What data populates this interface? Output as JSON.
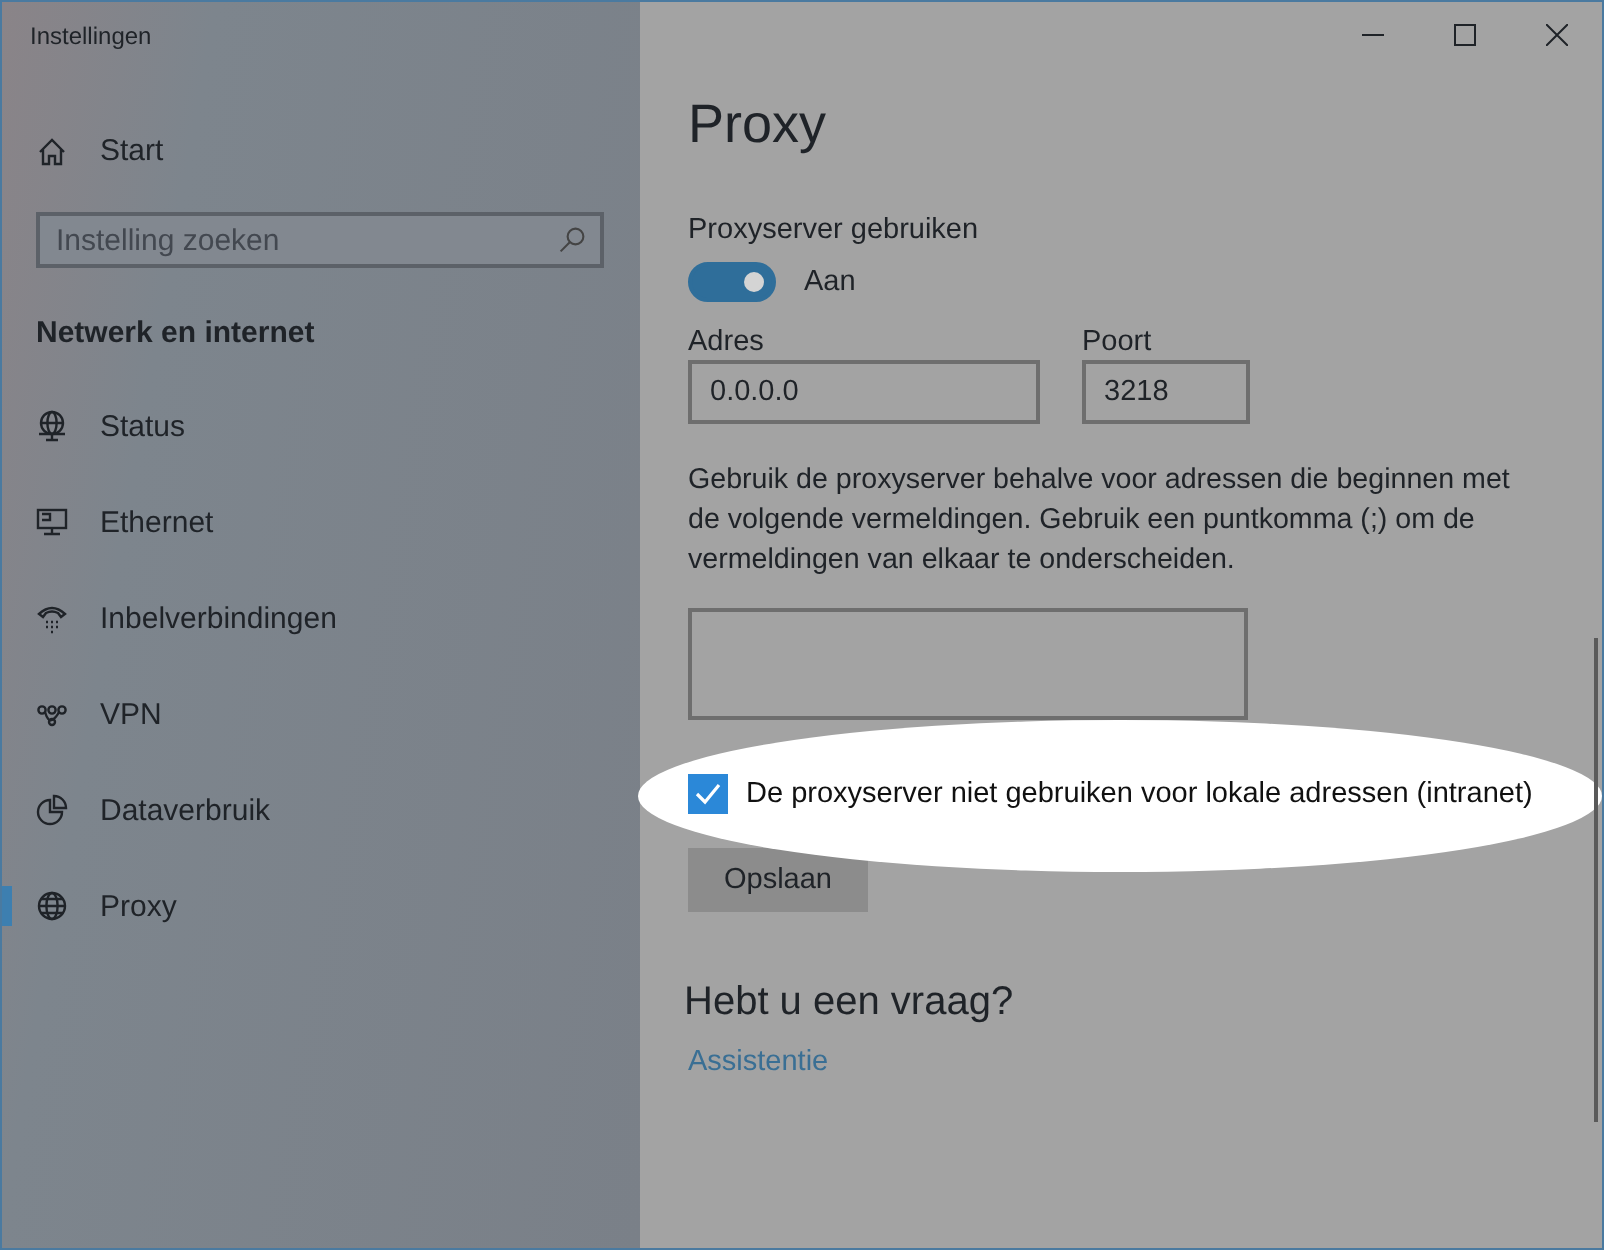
{
  "window": {
    "title": "Instellingen"
  },
  "sidebar": {
    "home": {
      "label": "Start"
    },
    "search": {
      "placeholder": "Instelling zoeken"
    },
    "section": "Netwerk en internet",
    "items": [
      {
        "label": "Status",
        "kind": "status",
        "selected": false
      },
      {
        "label": "Ethernet",
        "kind": "ethernet",
        "selected": false
      },
      {
        "label": "Inbelverbindingen",
        "kind": "dialup",
        "selected": false
      },
      {
        "label": "VPN",
        "kind": "vpn",
        "selected": false
      },
      {
        "label": "Dataverbruik",
        "kind": "data",
        "selected": false
      },
      {
        "label": "Proxy",
        "kind": "proxy",
        "selected": true
      }
    ]
  },
  "page": {
    "title": "Proxy",
    "proxy_toggle": {
      "label": "Proxyserver gebruiken",
      "on": true,
      "state_text": "Aan"
    },
    "address": {
      "label": "Adres",
      "value": "0.0.0.0"
    },
    "port": {
      "label": "Poort",
      "value": "3218"
    },
    "exceptions": {
      "description": "Gebruik de proxyserver behalve voor adressen die beginnen met de volgende vermeldingen. Gebruik een puntkomma (;) om de vermeldingen van elkaar te onderscheiden."
    },
    "local_bypass": {
      "label": "De proxyserver niet gebruiken voor lokale adressen (intranet)",
      "checked": true
    },
    "save_button": "Opslaan",
    "help": {
      "title": "Hebt u een vraag?",
      "link": "Assistentie"
    }
  }
}
